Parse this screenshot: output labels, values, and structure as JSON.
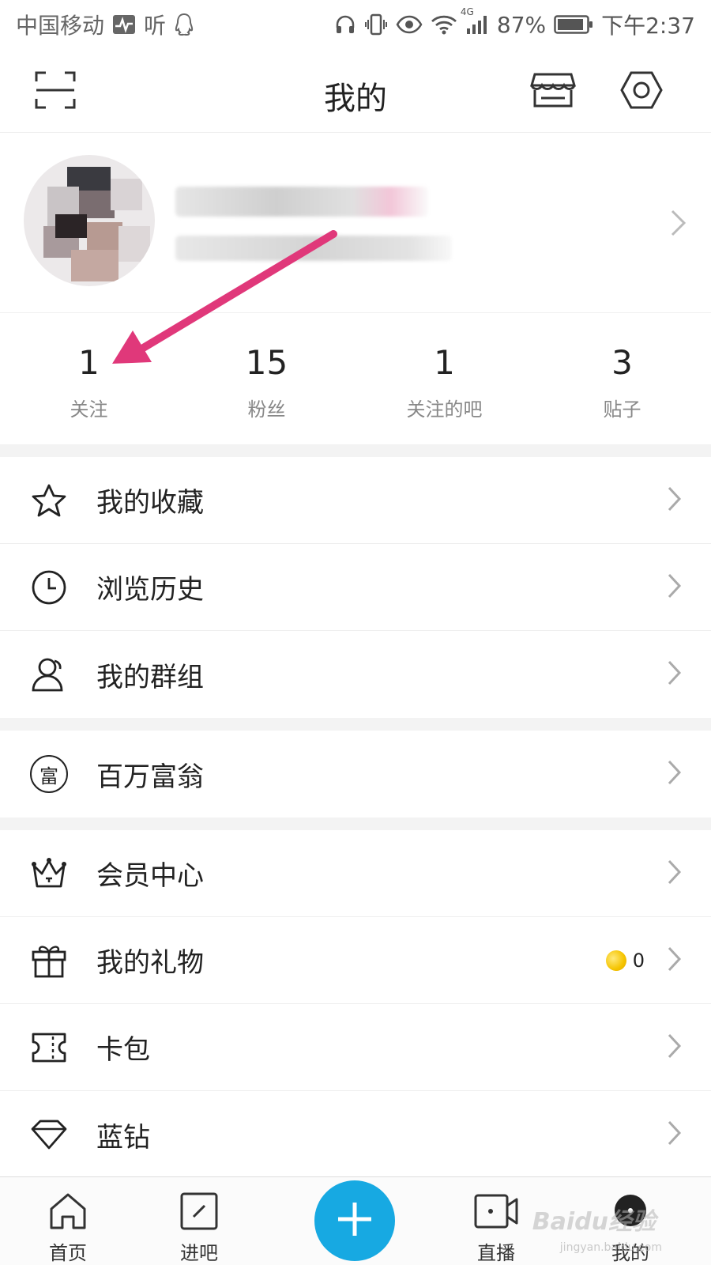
{
  "status_bar": {
    "carrier": "中国移动",
    "listen_label": "听",
    "network": "4G",
    "battery": "87%",
    "time": "下午2:37"
  },
  "header": {
    "title": "我的",
    "icons": [
      "scan-icon",
      "store-icon",
      "settings-icon"
    ]
  },
  "stats": [
    {
      "value": "1",
      "label": "关注"
    },
    {
      "value": "15",
      "label": "粉丝"
    },
    {
      "value": "1",
      "label": "关注的吧"
    },
    {
      "value": "3",
      "label": "贴子"
    }
  ],
  "menu": {
    "favorites": "我的收藏",
    "history": "浏览历史",
    "groups": "我的群组",
    "millionaire": "百万富翁",
    "millionaire_glyph": "富",
    "member_center": "会员中心",
    "gifts": "我的礼物",
    "gift_count": "0",
    "card_wallet": "卡包",
    "blue_diamond": "蓝钻"
  },
  "bottom_nav": {
    "home": "首页",
    "enter_bar": "进吧",
    "live": "直播",
    "mine": "我的"
  },
  "watermark": {
    "text": "Baidu经验",
    "sub": "jingyan.baidu.com"
  },
  "colors": {
    "accent": "#17a9e2",
    "arrow": "#e0387a",
    "divider": "#f3f3f3"
  }
}
